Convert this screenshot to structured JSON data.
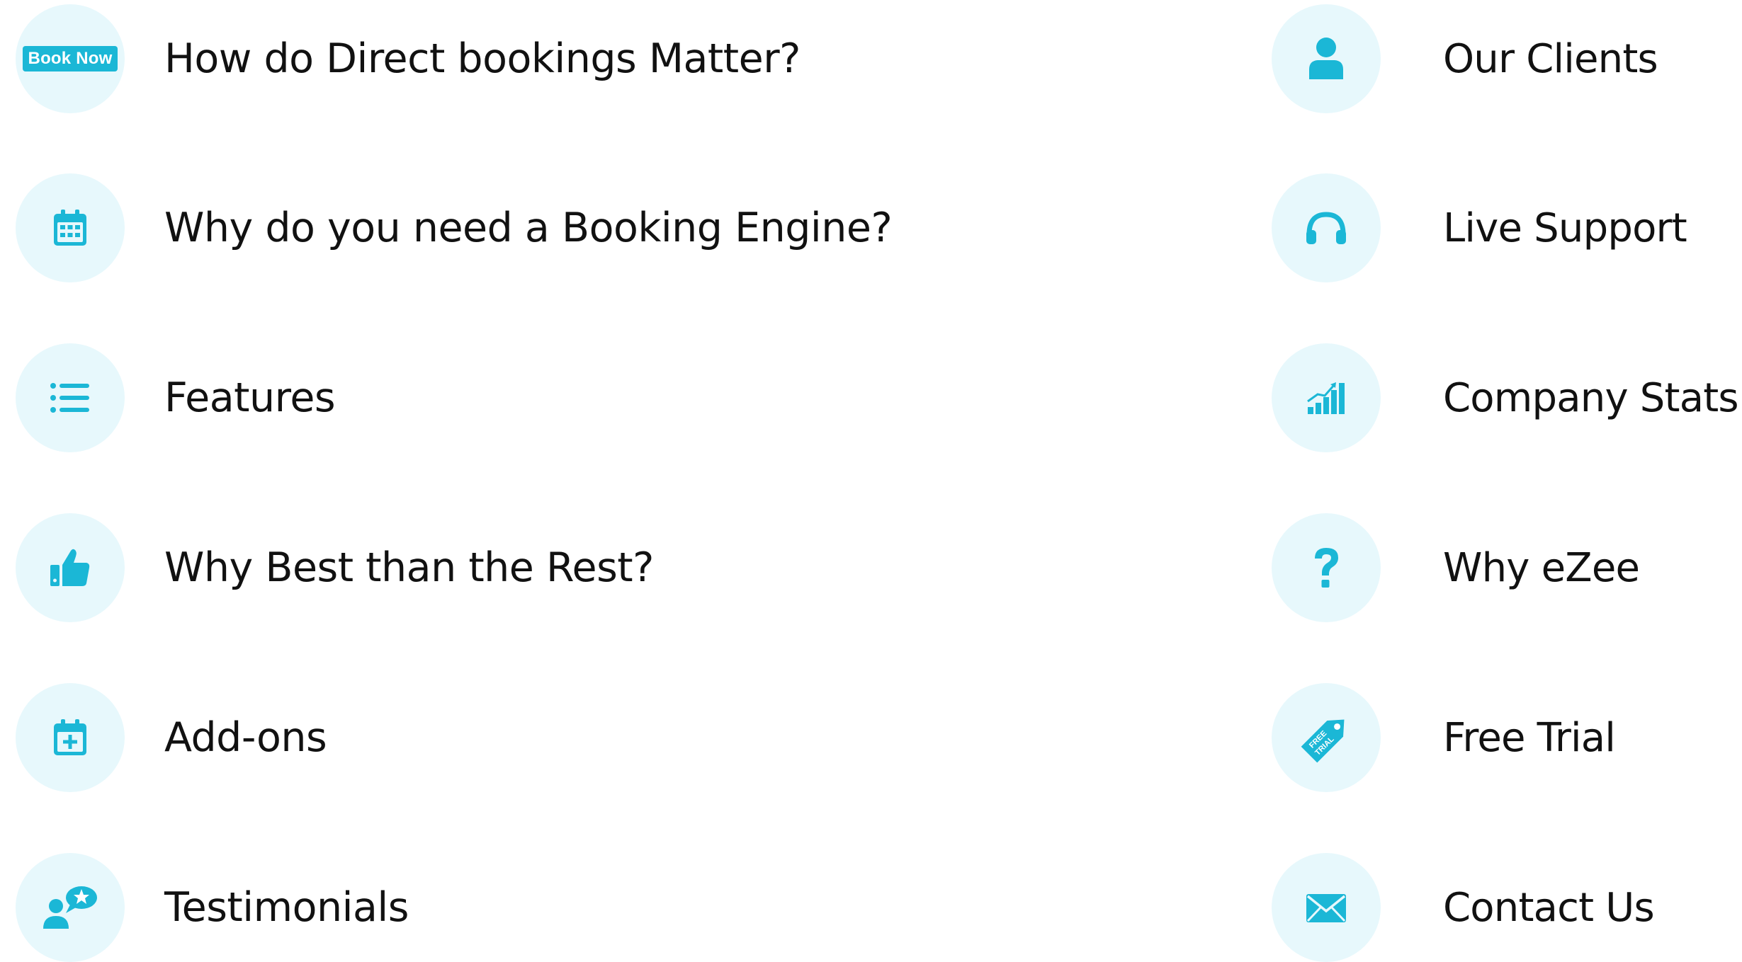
{
  "accent_color": "#1bb7d6",
  "circle_color": "#e7f8fc",
  "left_items": [
    {
      "label": "How do  Direct bookings  Matter?",
      "icon": "book-now-badge",
      "badge_text": "Book Now"
    },
    {
      "label": "Why do you need a  Booking  Engine?",
      "icon": "calendar-icon"
    },
    {
      "label": "Features",
      "icon": "list-icon"
    },
    {
      "label": "Why Best than the  Rest?",
      "icon": "thumbs-up-icon"
    },
    {
      "label": "Add-ons",
      "icon": "calendar-plus-icon"
    },
    {
      "label": "Testimonials",
      "icon": "user-star-icon"
    }
  ],
  "right_items": [
    {
      "label": "Our Clients",
      "icon": "user-icon"
    },
    {
      "label": "Live Support",
      "icon": "headphones-icon"
    },
    {
      "label": "Company Stats",
      "icon": "bar-chart-icon"
    },
    {
      "label": "Why eZee",
      "icon": "question-icon"
    },
    {
      "label": "Free Trial",
      "icon": "free-trial-tag-icon",
      "badge_text": "FREE TRIAL"
    },
    {
      "label": "Contact Us",
      "icon": "envelope-icon"
    }
  ]
}
